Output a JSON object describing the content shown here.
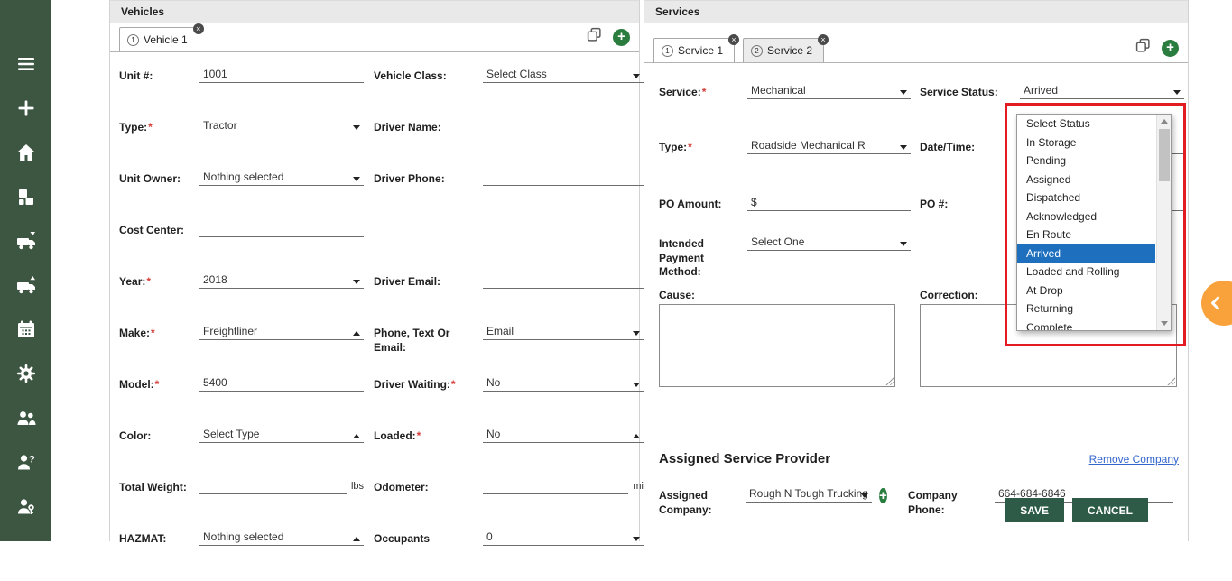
{
  "colors": {
    "sidebar_green": "#3d5642",
    "accent_green": "#2a7d3f",
    "highlight_blue": "#1e70bf",
    "annotation_red": "#e31b23",
    "orange_fab": "#f9a23c",
    "button_green": "#2d5b47",
    "link_blue": "#3366cc"
  },
  "icons": {
    "plus_glyph": "+",
    "close_glyph": "×",
    "sidebar": [
      "menu-icon",
      "add-icon",
      "home-icon",
      "packages-icon",
      "truck-in-icon",
      "truck-out-icon",
      "calendar-icon",
      "settings-icon",
      "users-icon",
      "user-question-icon",
      "user-key-icon"
    ]
  },
  "vehicles": {
    "title": "Vehicles",
    "tab": {
      "number": "1",
      "label": "Vehicle 1"
    },
    "fields": {
      "unit_number": {
        "label": "Unit #:",
        "value": "1001"
      },
      "vehicle_class": {
        "label": "Vehicle Class:",
        "value": "Select Class"
      },
      "type": {
        "label": "Type:",
        "req": "*",
        "value": "Tractor"
      },
      "driver_name": {
        "label": "Driver Name:",
        "value": ""
      },
      "unit_owner": {
        "label": "Unit Owner:",
        "value": "Nothing selected"
      },
      "driver_phone": {
        "label": "Driver Phone:",
        "value": ""
      },
      "cost_center": {
        "label": "Cost Center:",
        "value": ""
      },
      "year": {
        "label": "Year:",
        "req": "*",
        "value": "2018"
      },
      "driver_email": {
        "label": "Driver Email:",
        "value": ""
      },
      "make": {
        "label": "Make:",
        "req": "*",
        "value": "Freightliner"
      },
      "phone_text_or_email": {
        "label": "Phone, Text Or Email:",
        "value": "Email"
      },
      "model": {
        "label": "Model:",
        "req": "*",
        "value": "5400"
      },
      "driver_waiting": {
        "label": "Driver Waiting:",
        "req": "*",
        "value": "No"
      },
      "color": {
        "label": "Color:",
        "value": "Select Type"
      },
      "loaded": {
        "label": "Loaded:",
        "req": "*",
        "value": "No"
      },
      "total_weight": {
        "label": "Total Weight:",
        "value": "",
        "suffix": "lbs"
      },
      "odometer": {
        "label": "Odometer:",
        "value": "",
        "suffix": "mi"
      },
      "hazmat": {
        "label": "HAZMAT:",
        "value": "Nothing selected"
      },
      "occupants": {
        "label": "Occupants",
        "value": "0"
      }
    }
  },
  "services": {
    "title": "Services",
    "tabs": [
      {
        "number": "1",
        "label": "Service 1"
      },
      {
        "number": "2",
        "label": "Service 2"
      }
    ],
    "fields": {
      "service": {
        "label": "Service:",
        "req": "*",
        "value": "Mechanical"
      },
      "service_status": {
        "label": "Service Status:",
        "value": "Arrived"
      },
      "type": {
        "label": "Type:",
        "req": "*",
        "value": "Roadside Mechanical R"
      },
      "date_time": {
        "label": "Date/Time:",
        "value": ""
      },
      "po_amount": {
        "label": "PO Amount:",
        "prefix": "$",
        "value": ""
      },
      "po_number": {
        "label": "PO #:",
        "value": ""
      },
      "intended_payment_method": {
        "label": "Intended Payment Method:",
        "value": "Select One"
      },
      "cause": {
        "label": "Cause:",
        "value": ""
      },
      "correction": {
        "label": "Correction:",
        "value": ""
      }
    },
    "status_dropdown": {
      "selected": "Arrived",
      "options": [
        "Select Status",
        "In Storage",
        "Pending",
        "Assigned",
        "Dispatched",
        "Acknowledged",
        "En Route",
        "Arrived",
        "Loaded and Rolling",
        "At Drop",
        "Returning",
        "Complete"
      ]
    },
    "provider": {
      "heading": "Assigned Service Provider",
      "remove_link": "Remove Company",
      "assigned_company": {
        "label": "Assigned Company:",
        "value": "Rough N Tough Trucking"
      },
      "company_phone": {
        "label": "Company Phone:",
        "value": "664-684-6846"
      },
      "save_label": "SAVE",
      "cancel_label": "CANCEL"
    }
  }
}
